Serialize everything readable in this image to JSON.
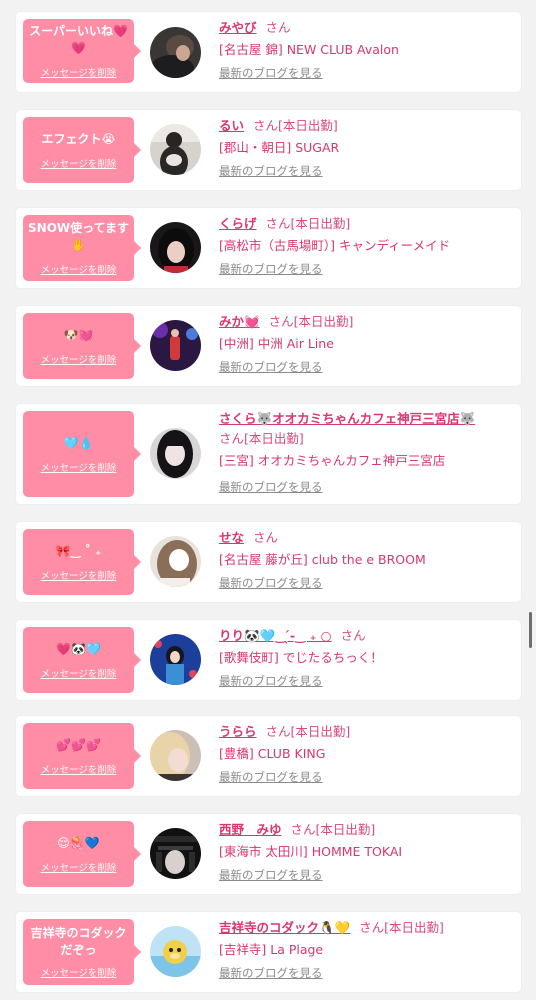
{
  "common": {
    "delete_label": "メッセージを削除",
    "blog_label": "最新のブログを見る",
    "accent_color": "#fe8da5",
    "name_color": "#d9366f"
  },
  "items": [
    {
      "message": "スーパーいいね💗💗",
      "name": "みやび",
      "suffix": "さん",
      "shop": "[名古屋 錦] NEW CLUB Avalon",
      "avatar_icon": "woman-photo-icon"
    },
    {
      "message": "エフェクト😭",
      "name": "るい",
      "suffix": "さん[本日出勤]",
      "shop": "[郡山・朝日] SUGAR",
      "avatar_icon": "woman-photo-icon"
    },
    {
      "message": "SNOW使ってます✋",
      "name": "くらげ",
      "suffix": "さん[本日出勤]",
      "shop": "[高松市（古馬場町）] キャンディーメイド",
      "avatar_icon": "woman-photo-icon"
    },
    {
      "message": "🐶💓",
      "name": "みか💓",
      "suffix": "さん[本日出勤]",
      "shop": "[中洲] 中洲 Air Line",
      "avatar_icon": "woman-photo-icon"
    },
    {
      "message": "🩵💧",
      "name": "さくら🐺オオカミちゃんカフェ神戸三宮店🐺",
      "suffix": "さん[本日出勤]",
      "shop": "[三宮] オオカミちゃんカフェ神戸三宮店",
      "avatar_icon": "woman-photo-icon"
    },
    {
      "message": "🎀‿︎ ˚ ₊",
      "name": "せな",
      "suffix": "さん",
      "shop": "[名古屋 藤が丘] club the e BROOM",
      "avatar_icon": "woman-photo-icon"
    },
    {
      "message": "💗🐼🩵",
      "name": "りり🐼🩵‿︎ ̖́-‿︎ ₊ ○",
      "suffix": "さん",
      "shop": "[歌舞伎町] でじたるちっく！",
      "avatar_icon": "woman-photo-icon"
    },
    {
      "message": "💕💕💕",
      "name": "うらら",
      "suffix": "さん[本日出勤]",
      "shop": "[豊橋] CLUB KING",
      "avatar_icon": "woman-photo-icon"
    },
    {
      "message": "😌🪼💙",
      "name": "西野　みゆ",
      "suffix": "さん[本日出勤]",
      "shop": "[東海市 太田川] HOMME TOKAI",
      "avatar_icon": "woman-photo-icon"
    },
    {
      "message": "吉祥寺のコダックだぞっ",
      "name": "吉祥寺のコダック🐧💛",
      "suffix": "さん[本日出勤]",
      "shop": "[吉祥寺] La Plage",
      "avatar_icon": "pokemon-photo-icon"
    }
  ]
}
